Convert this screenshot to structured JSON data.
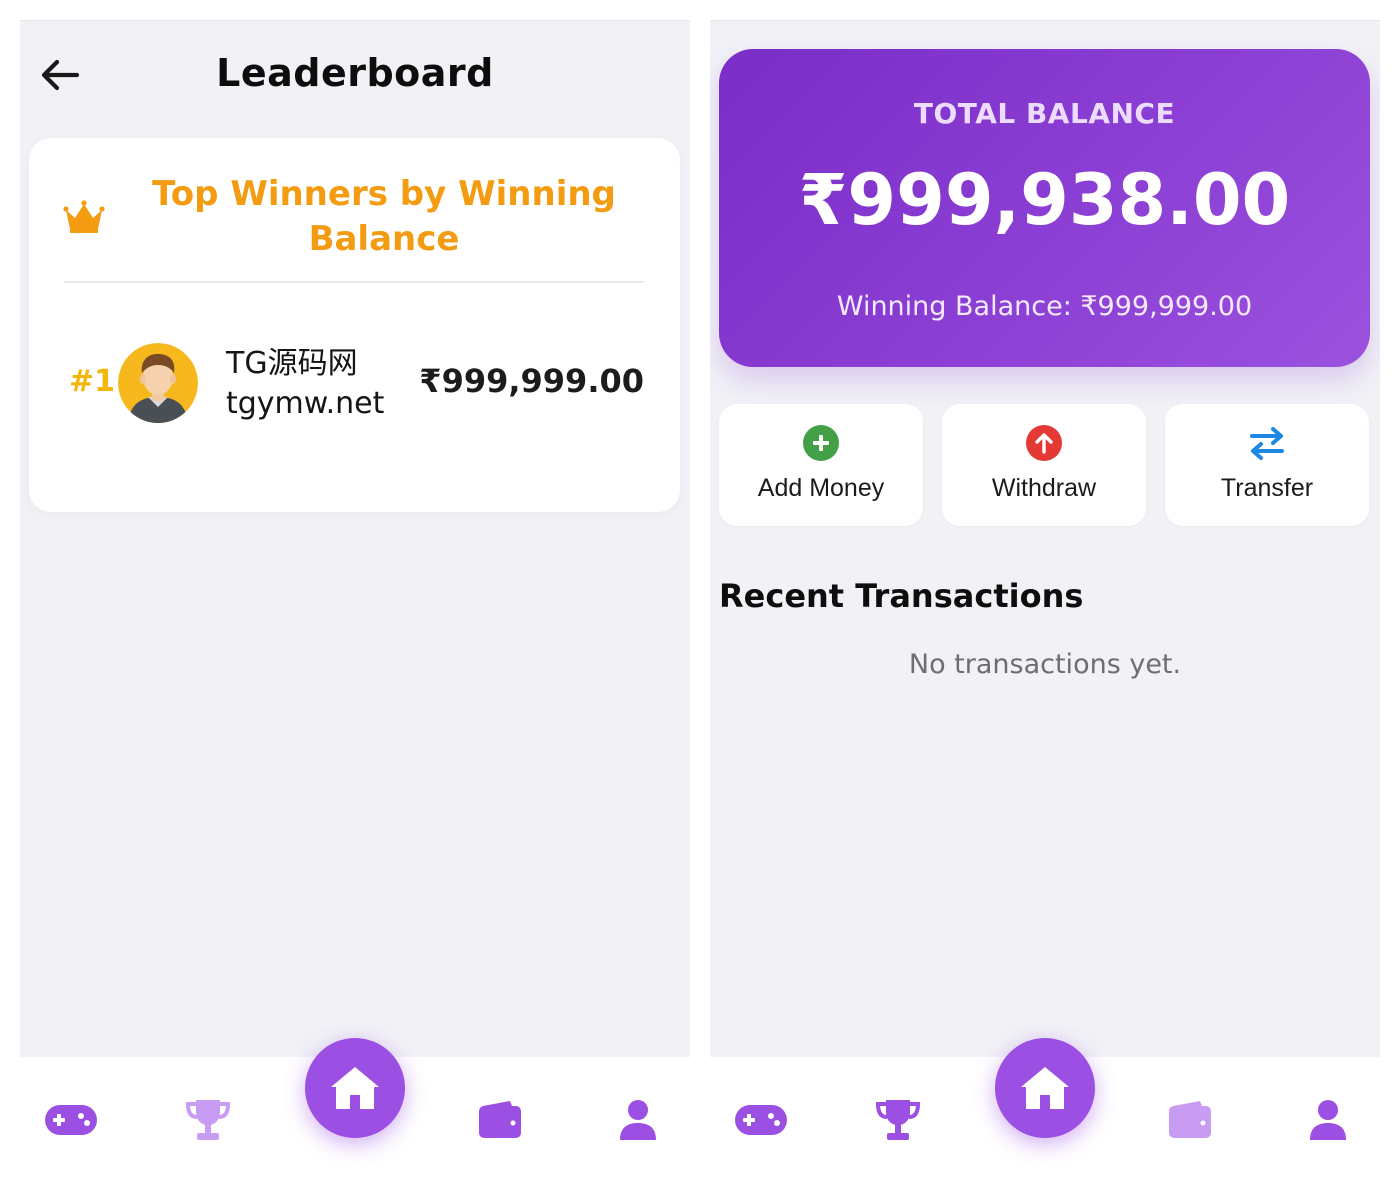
{
  "leaderboard": {
    "title": "Leaderboard",
    "card_title": "Top Winners by Winning Balance",
    "entries": [
      {
        "rank": "#1",
        "name_line1": "TG源码网",
        "name_line2": "tgymw.net",
        "amount": "₹999,999.00"
      }
    ]
  },
  "wallet": {
    "total_label": "TOTAL BALANCE",
    "total_amount": "₹999,938.00",
    "winning_balance": "Winning Balance: ₹999,999.00",
    "actions": [
      {
        "label": "Add Money",
        "icon": "plus-circle-icon",
        "color": "#43a047"
      },
      {
        "label": "Withdraw",
        "icon": "arrow-up-circle-icon",
        "color": "#e53935"
      },
      {
        "label": "Transfer",
        "icon": "swap-arrows-icon",
        "color": "#1e88e5"
      }
    ],
    "recent_title": "Recent Transactions",
    "empty_text": "No transactions yet."
  },
  "nav": {
    "items": [
      "gamepad-icon",
      "trophy-icon",
      "home-icon",
      "wallet-icon",
      "user-icon"
    ],
    "left_screen_active": "home-icon",
    "right_screen_active": "home-icon"
  },
  "colors": {
    "accent": "#9b4fe3",
    "accent_light": "#c79cf2",
    "title_orange": "#f39c12",
    "rank_gold": "#f5b60a",
    "background": "#f1f1f6"
  }
}
